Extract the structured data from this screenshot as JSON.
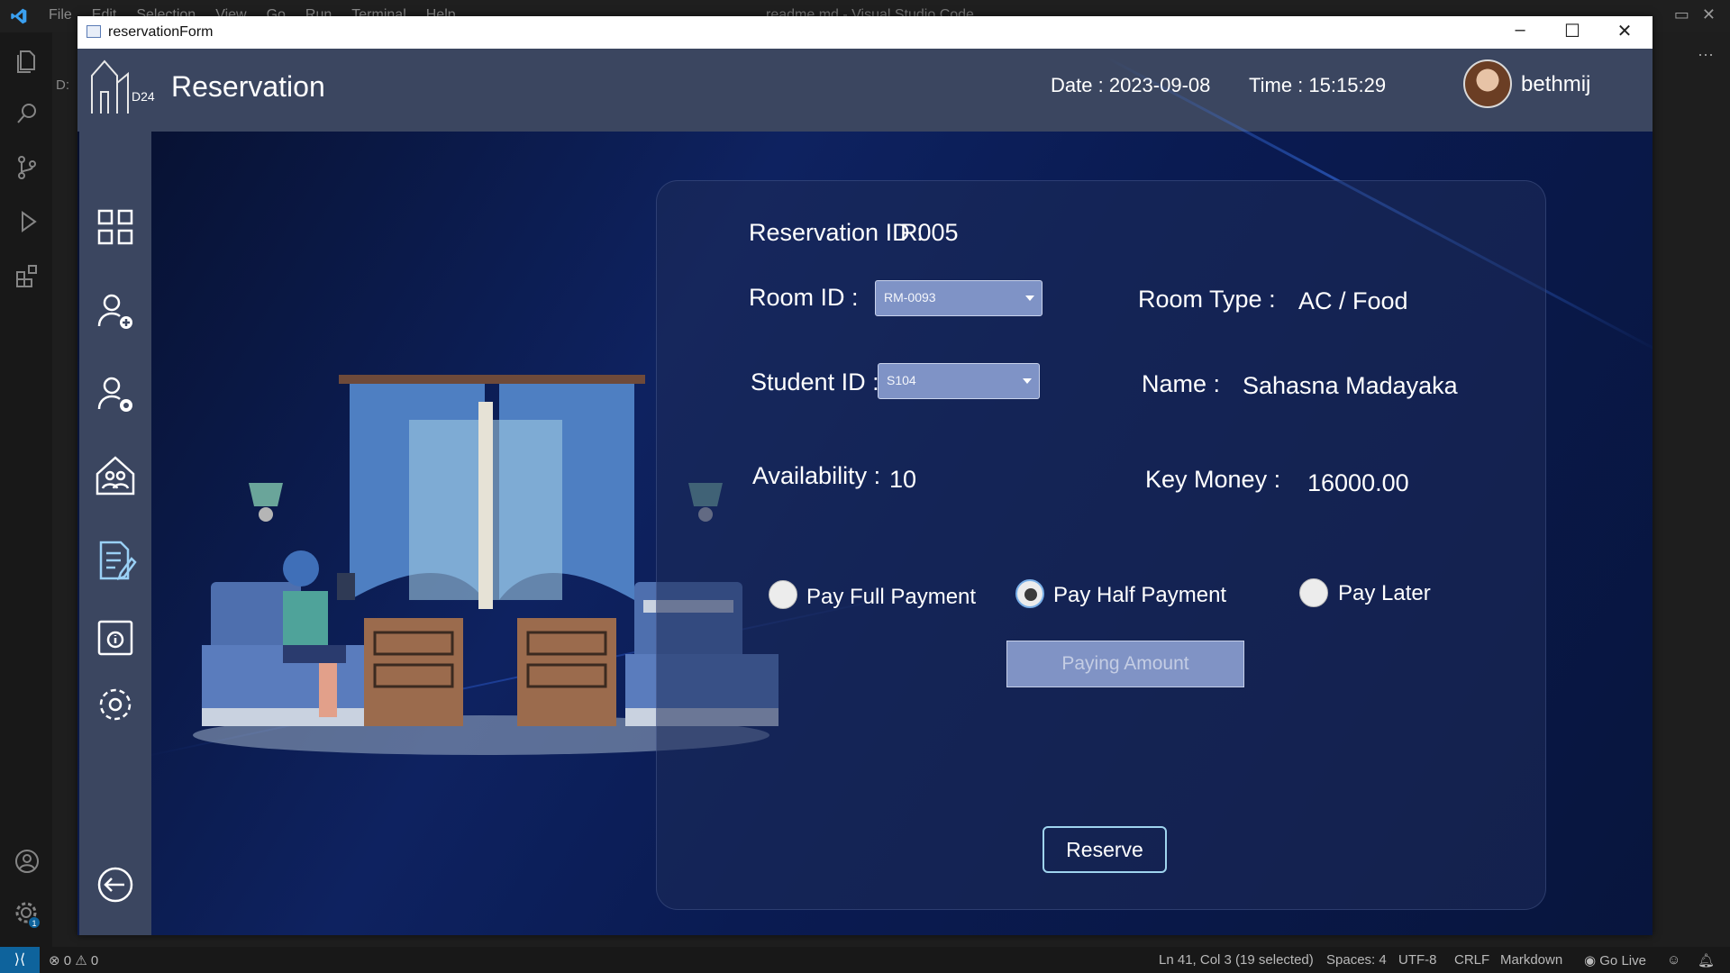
{
  "vscode": {
    "menu": [
      "File",
      "Edit",
      "Selection",
      "View",
      "Go",
      "Run",
      "Terminal",
      "Help"
    ],
    "title": "readme.md - Visual Studio Code",
    "gutter_text": "D:",
    "status": {
      "errors": "0",
      "warnings": "0",
      "position": "Ln 41, Col 3 (19 selected)",
      "spaces": "Spaces: 4",
      "encoding": "UTF-8",
      "eol": "CRLF",
      "language": "Markdown",
      "golive": "Go Live",
      "settings_badge": "1"
    }
  },
  "window": {
    "title": "reservationForm",
    "controls": {
      "minimize": "–",
      "maximize": "☐",
      "close": "✕"
    }
  },
  "header": {
    "title": "Reservation",
    "logo_text": "D24",
    "date_label": "Date :",
    "date_value": "2023-09-08",
    "time_label": "Time :",
    "time_value": "15:15:29",
    "username": "bethmij"
  },
  "sidebar": {
    "items": [
      {
        "name": "dashboard-icon"
      },
      {
        "name": "add-student-icon"
      },
      {
        "name": "manage-student-icon"
      },
      {
        "name": "rooms-icon"
      },
      {
        "name": "reservation-icon",
        "active": true
      },
      {
        "name": "info-icon"
      },
      {
        "name": "settings-icon"
      },
      {
        "name": "logout-icon"
      }
    ]
  },
  "form": {
    "reservation_id_label": "Reservation ID :",
    "reservation_id_value": "R005",
    "room_id_label": "Room ID :",
    "room_id_value": "RM-0093",
    "room_type_label": "Room Type :",
    "room_type_value": "AC / Food",
    "student_id_label": "Student ID :",
    "student_id_value": "S104",
    "name_label": "Name :",
    "name_value": "Sahasna Madayaka",
    "availability_label": "Availability :",
    "availability_value": "10",
    "key_money_label": "Key Money :",
    "key_money_value": "16000.00",
    "payment_options": [
      {
        "label": "Pay Full Payment",
        "selected": false
      },
      {
        "label": "Pay Half Payment",
        "selected": true
      },
      {
        "label": "Pay Later",
        "selected": false
      }
    ],
    "paying_amount_placeholder": "Paying Amount",
    "reserve_label": "Reserve"
  },
  "colors": {
    "header_bg": "#3b4660",
    "window_bg": "#0b1a45",
    "combo_bg": "#7f93c6",
    "accent_border": "#9fd4ee"
  }
}
